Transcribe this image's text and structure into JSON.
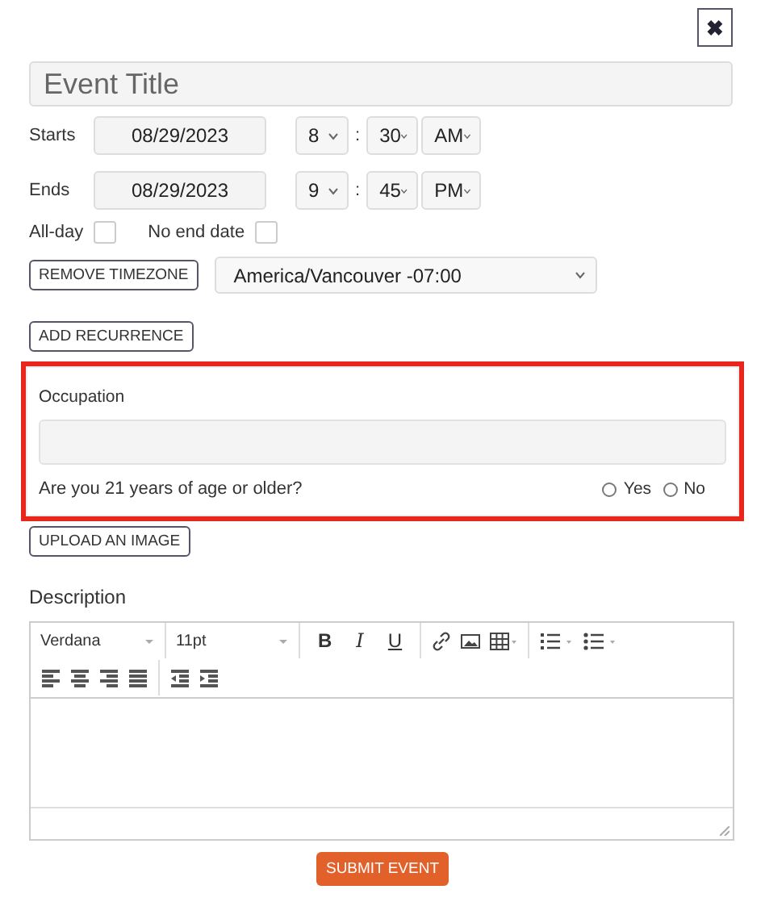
{
  "close_button": {
    "label": "✖"
  },
  "title_field": {
    "placeholder": "Event Title"
  },
  "starts": {
    "label": "Starts",
    "date": "08/29/2023",
    "hour": "8",
    "separator": ":",
    "minute": "30",
    "meridiem": "AM"
  },
  "ends": {
    "label": "Ends",
    "date": "08/29/2023",
    "hour": "9",
    "separator": ":",
    "minute": "45",
    "meridiem": "PM"
  },
  "options": [
    {
      "label": "All-day",
      "checked": false
    },
    {
      "label": "No end date",
      "checked": false
    }
  ],
  "remove_timezone_button": "REMOVE TIMEZONE",
  "timezone": "America/Vancouver -07:00",
  "add_recurrence_button": "ADD RECURRENCE",
  "custom_fields": {
    "highlighted": true,
    "occupation_label": "Occupation",
    "age_question": "Are you 21 years of age or older?",
    "age_options": [
      {
        "label": "Yes",
        "selected": false
      },
      {
        "label": "No",
        "selected": false
      }
    ]
  },
  "upload_button": "UPLOAD AN IMAGE",
  "description": {
    "label": "Description",
    "font": "Verdana",
    "size": "11pt",
    "format_buttons": [
      "B",
      "I",
      "U"
    ]
  },
  "submit_button": "SUBMIT EVENT"
}
